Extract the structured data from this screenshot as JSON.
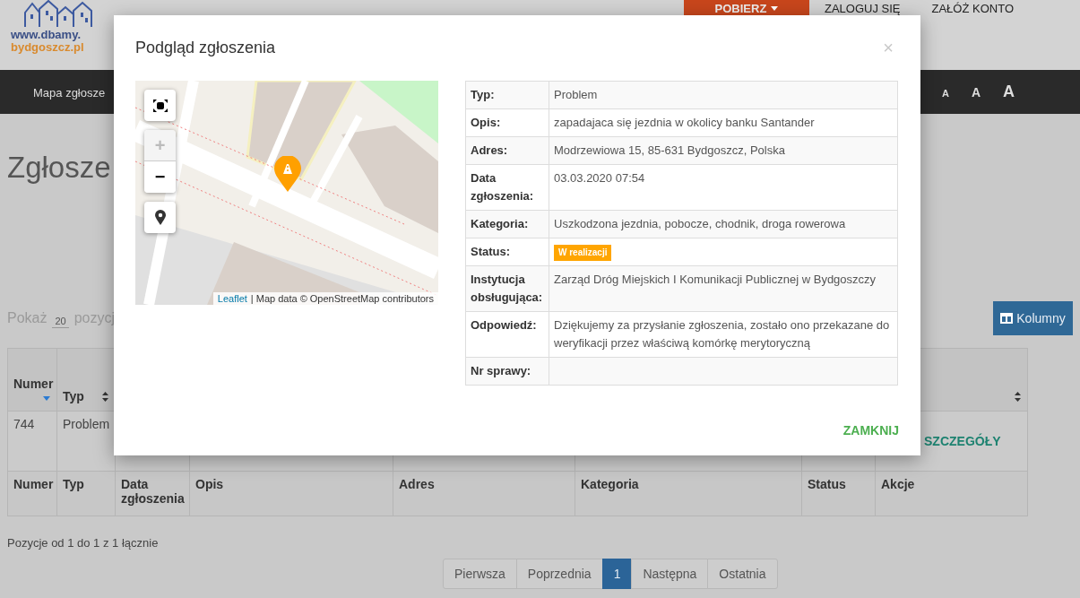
{
  "header": {
    "logo": {
      "line_1": "www.dbamy.",
      "line_2": "bydgoszcz.pl"
    },
    "download_button": "POBIERZ",
    "links": [
      "ZALOGUJ SIĘ",
      "ZAŁÓŻ KONTO"
    ]
  },
  "nav": {
    "items": [
      "Mapa zgłosze"
    ],
    "font_size_buttons": [
      "A",
      "A",
      "A"
    ]
  },
  "page": {
    "title": "Zgłosze",
    "length_label": "Pokaż",
    "length_value": "20",
    "length_suffix": "pozycj",
    "columns_button": "Kolumny"
  },
  "table": {
    "header": [
      {
        "label": "Numer",
        "sortable": true,
        "sorted_descending": true
      },
      {
        "label": "Typ",
        "sortable": true,
        "sorted_descending": false
      },
      {
        "sortable": true,
        "sorted_descending": false
      }
    ],
    "rows": [
      {
        "cells": [
          "744",
          "Problem"
        ],
        "action": "SZCZEGÓŁY"
      }
    ],
    "footer": [
      "Numer",
      "Typ",
      "Data zgłoszenia",
      "Opis",
      "Adres",
      "Kategoria",
      "Status",
      "Akcje"
    ]
  },
  "info": "Pozycje od 1 do 1 z 1 łącznie",
  "pagination": [
    {
      "label": "Pierwsza",
      "selected": false
    },
    {
      "label": "Poprzednia",
      "selected": false
    },
    {
      "label": "1",
      "selected": true
    },
    {
      "label": "Następna",
      "selected": false
    },
    {
      "label": "Ostatnia",
      "selected": false
    }
  ],
  "modal": {
    "title": "Podgląd zgłoszenia",
    "close": "×",
    "map": {
      "zoom_in": {
        "label": "+",
        "disabled": true
      },
      "zoom_out": {
        "label": "−",
        "disabled": false
      },
      "attribution_link": "Leaflet",
      "attribution_text": "| Map data © OpenStreetMap contributors"
    },
    "details": [
      {
        "label": "Typ:",
        "value": "Problem",
        "kind": "text"
      },
      {
        "label": "Opis:",
        "value": "zapadajaca się jezdnia w okolicy banku Santander",
        "kind": "text"
      },
      {
        "label": "Adres:",
        "value": "Modrzewiowa 15, 85-631 Bydgoszcz, Polska",
        "kind": "text"
      },
      {
        "label": "Data zgłoszenia:",
        "value": "03.03.2020 07:54",
        "kind": "text"
      },
      {
        "label": "Kategoria:",
        "value": "Uszkodzona jezdnia, pobocze, chodnik, droga rowerowa",
        "kind": "text"
      },
      {
        "label": "Status:",
        "value": "W realizacji",
        "kind": "badge",
        "color": "#ffa500"
      },
      {
        "label": "Instytucja obsługująca:",
        "value": "Zarząd Dróg Miejskich I Komunikacji Publicznej w Bydgoszczy",
        "kind": "text"
      },
      {
        "label": "Odpowiedź:",
        "value": "Dziękujemy za przysłanie zgłoszenia, zostało ono przekazane do weryfikacji przez właściwą komórkę merytoryczną",
        "kind": "text"
      },
      {
        "label": "Nr sprawy:",
        "kind": "empty"
      }
    ],
    "close_button": "ZAMKNIJ"
  }
}
